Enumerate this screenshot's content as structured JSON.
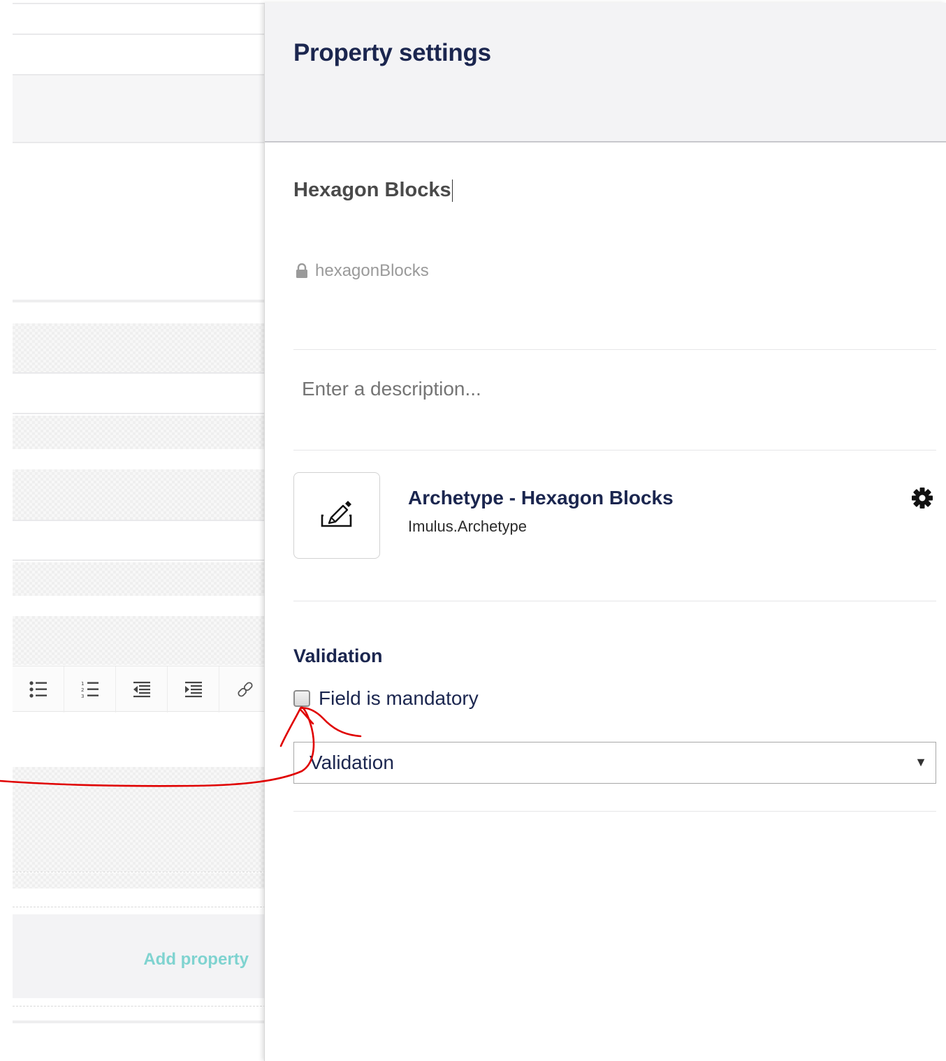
{
  "background_editor": {
    "toolbar_buttons": [
      {
        "icon": "bulleted-list-icon"
      },
      {
        "icon": "numbered-list-icon"
      },
      {
        "icon": "outdent-icon"
      },
      {
        "icon": "indent-icon"
      },
      {
        "icon": "link-icon"
      }
    ],
    "add_property_label": "Add property"
  },
  "panel": {
    "title": "Property settings",
    "name_value": "Hexagon Blocks",
    "alias_icon": "lock-icon",
    "alias": "hexagonBlocks",
    "description_placeholder": "Enter a description...",
    "editor": {
      "icon": "edit-sign-icon",
      "name": "Archetype - Hexagon Blocks",
      "alias": "Imulus.Archetype",
      "settings_icon": "gear-icon"
    },
    "validation": {
      "heading": "Validation",
      "mandatory_label": "Field is mandatory",
      "mandatory_checked": false,
      "select_value": "Validation"
    }
  },
  "colors": {
    "accent_text": "#1b264f",
    "add_property": "#7fd3d0",
    "annotation": "#e00000"
  }
}
